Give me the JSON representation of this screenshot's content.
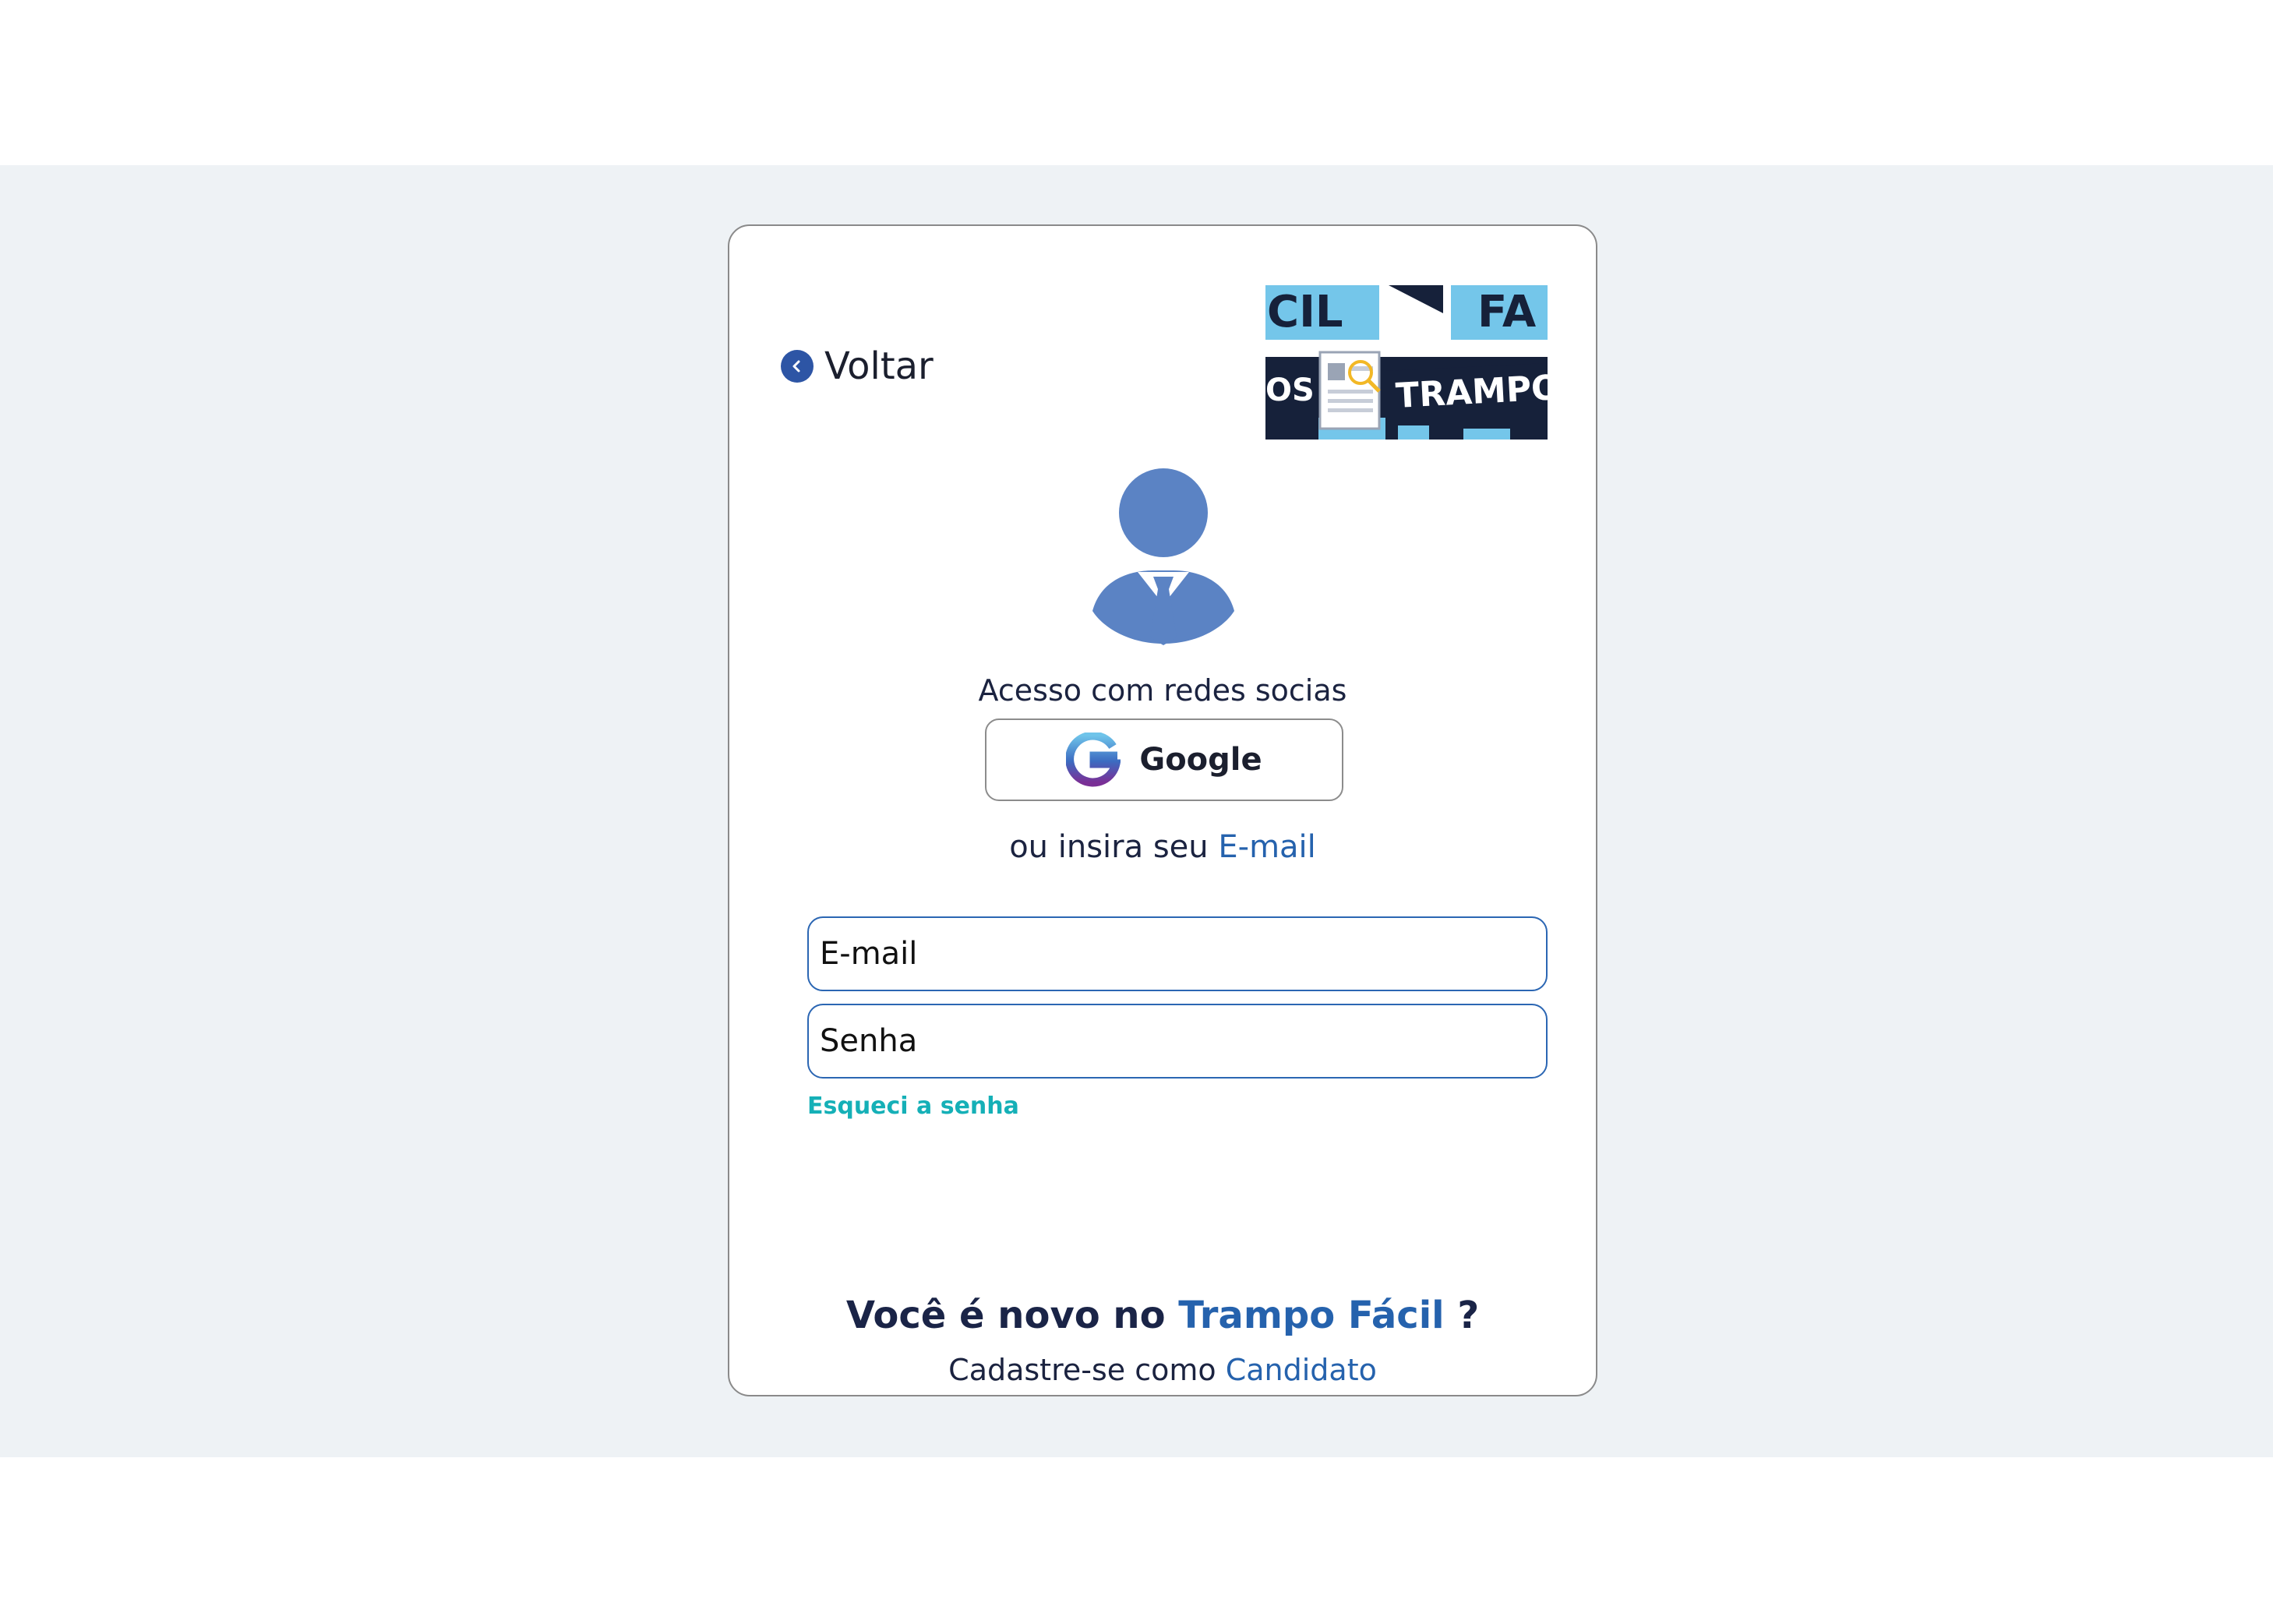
{
  "back": {
    "label": "Voltar",
    "icon": "chevron-left-icon"
  },
  "logo": {
    "text_top_left": "CIL",
    "text_top_right": "FA",
    "text_bottom_left": "OS",
    "text_bottom_right": "TRAMPO"
  },
  "social": {
    "title": "Acesso com redes socias",
    "google_label": "Google"
  },
  "or_line": {
    "prefix": "ou insira seu ",
    "link": "E-mail"
  },
  "form": {
    "email_placeholder": "E-mail",
    "password_placeholder": "Senha",
    "forgot_label": "Esqueci a senha"
  },
  "footer": {
    "new_prefix": "Você é novo no ",
    "brand": "Trampo Fácil",
    "new_suffix": " ?",
    "signup_prefix": "Cadastre-se como ",
    "signup_link": "Candidato"
  },
  "colors": {
    "accent": "#2562ad",
    "teal": "#15b0b7",
    "avatar": "#5b83c4",
    "navy": "#1a2447",
    "background": "#eef2f5"
  }
}
